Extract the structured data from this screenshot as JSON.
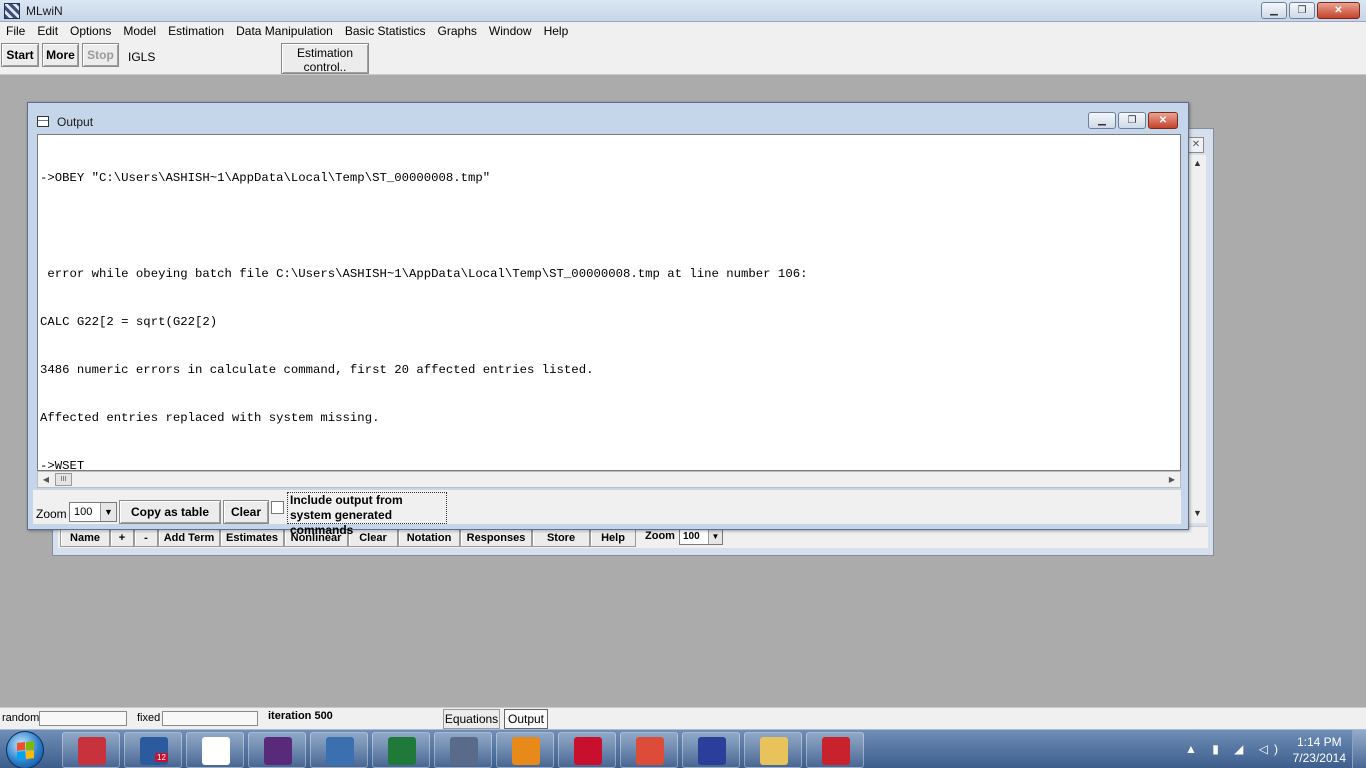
{
  "app": {
    "title": "MLwiN"
  },
  "title_buttons": {
    "minimize": "▁",
    "maximize": "❐",
    "close": "✕"
  },
  "menu": [
    "File",
    "Edit",
    "Options",
    "Model",
    "Estimation",
    "Data Manipulation",
    "Basic Statistics",
    "Graphs",
    "Window",
    "Help"
  ],
  "toolbar": {
    "start": "Start",
    "more": "More",
    "stop": "Stop",
    "method": "IGLS",
    "estimation_control_line1": "Estimation",
    "estimation_control_line2": "control.."
  },
  "output_window": {
    "title": "Output",
    "lines": [
      "->OBEY \"C:\\Users\\ASHISH~1\\AppData\\Local\\Temp\\ST_00000008.tmp\"",
      "",
      " error while obeying batch file C:\\Users\\ASHISH~1\\AppData\\Local\\Temp\\ST_00000008.tmp at line number 106:",
      "CALC G22[2 = sqrt(G22[2)",
      "3486 numeric errors in calculate command, first 20 affected entries listed.",
      "Affected entries replaced with system missing.",
      "->WSET"
    ],
    "zoom_label": "Zoom",
    "zoom_value": "100",
    "copy_as_table": "Copy as table",
    "clear": "Clear",
    "include_label": "Include output from system generated commands",
    "include_checked": false,
    "hscroll_thumb_glyph": "III"
  },
  "equations_window": {
    "buttons": [
      "Name",
      "+",
      "-",
      "Add Term",
      "Estimates",
      "Nonlinear",
      "Clear",
      "Notation",
      "Responses",
      "Store",
      "Help"
    ],
    "zoom_label": "Zoom",
    "zoom_value": "100"
  },
  "statusbar": {
    "random_label": "random",
    "fixed_label": "fixed",
    "iteration": "iteration 500",
    "tabs": [
      "Equations",
      "Output"
    ],
    "active_tab": "Output"
  },
  "taskbar": {
    "apps": [
      {
        "name": "statistics-app-icon",
        "color": "#c8323c"
      },
      {
        "name": "grid-app-icon",
        "color": "#2c5a9e",
        "badge": "12"
      },
      {
        "name": "network-app-icon",
        "color": "#ffffff"
      },
      {
        "name": "cald-app-icon",
        "color": "#5a2a7a"
      },
      {
        "name": "email-app-icon",
        "color": "#3a6fb0"
      },
      {
        "name": "excel-app-icon",
        "color": "#1f7a3a"
      },
      {
        "name": "mlwin-app-icon",
        "color": "#5a6a8a"
      },
      {
        "name": "sync-app-icon",
        "color": "#e88a1a"
      },
      {
        "name": "mendeley-app-icon",
        "color": "#c8102e"
      },
      {
        "name": "chrome-app-icon",
        "color": "#dd4b39"
      },
      {
        "name": "mathtype-app-icon",
        "color": "#2a3e9a"
      },
      {
        "name": "folder-app-icon",
        "color": "#e8c25a"
      },
      {
        "name": "pdf-app-icon",
        "color": "#c8232c"
      }
    ],
    "time": "1:14 PM",
    "date": "7/23/2014"
  }
}
